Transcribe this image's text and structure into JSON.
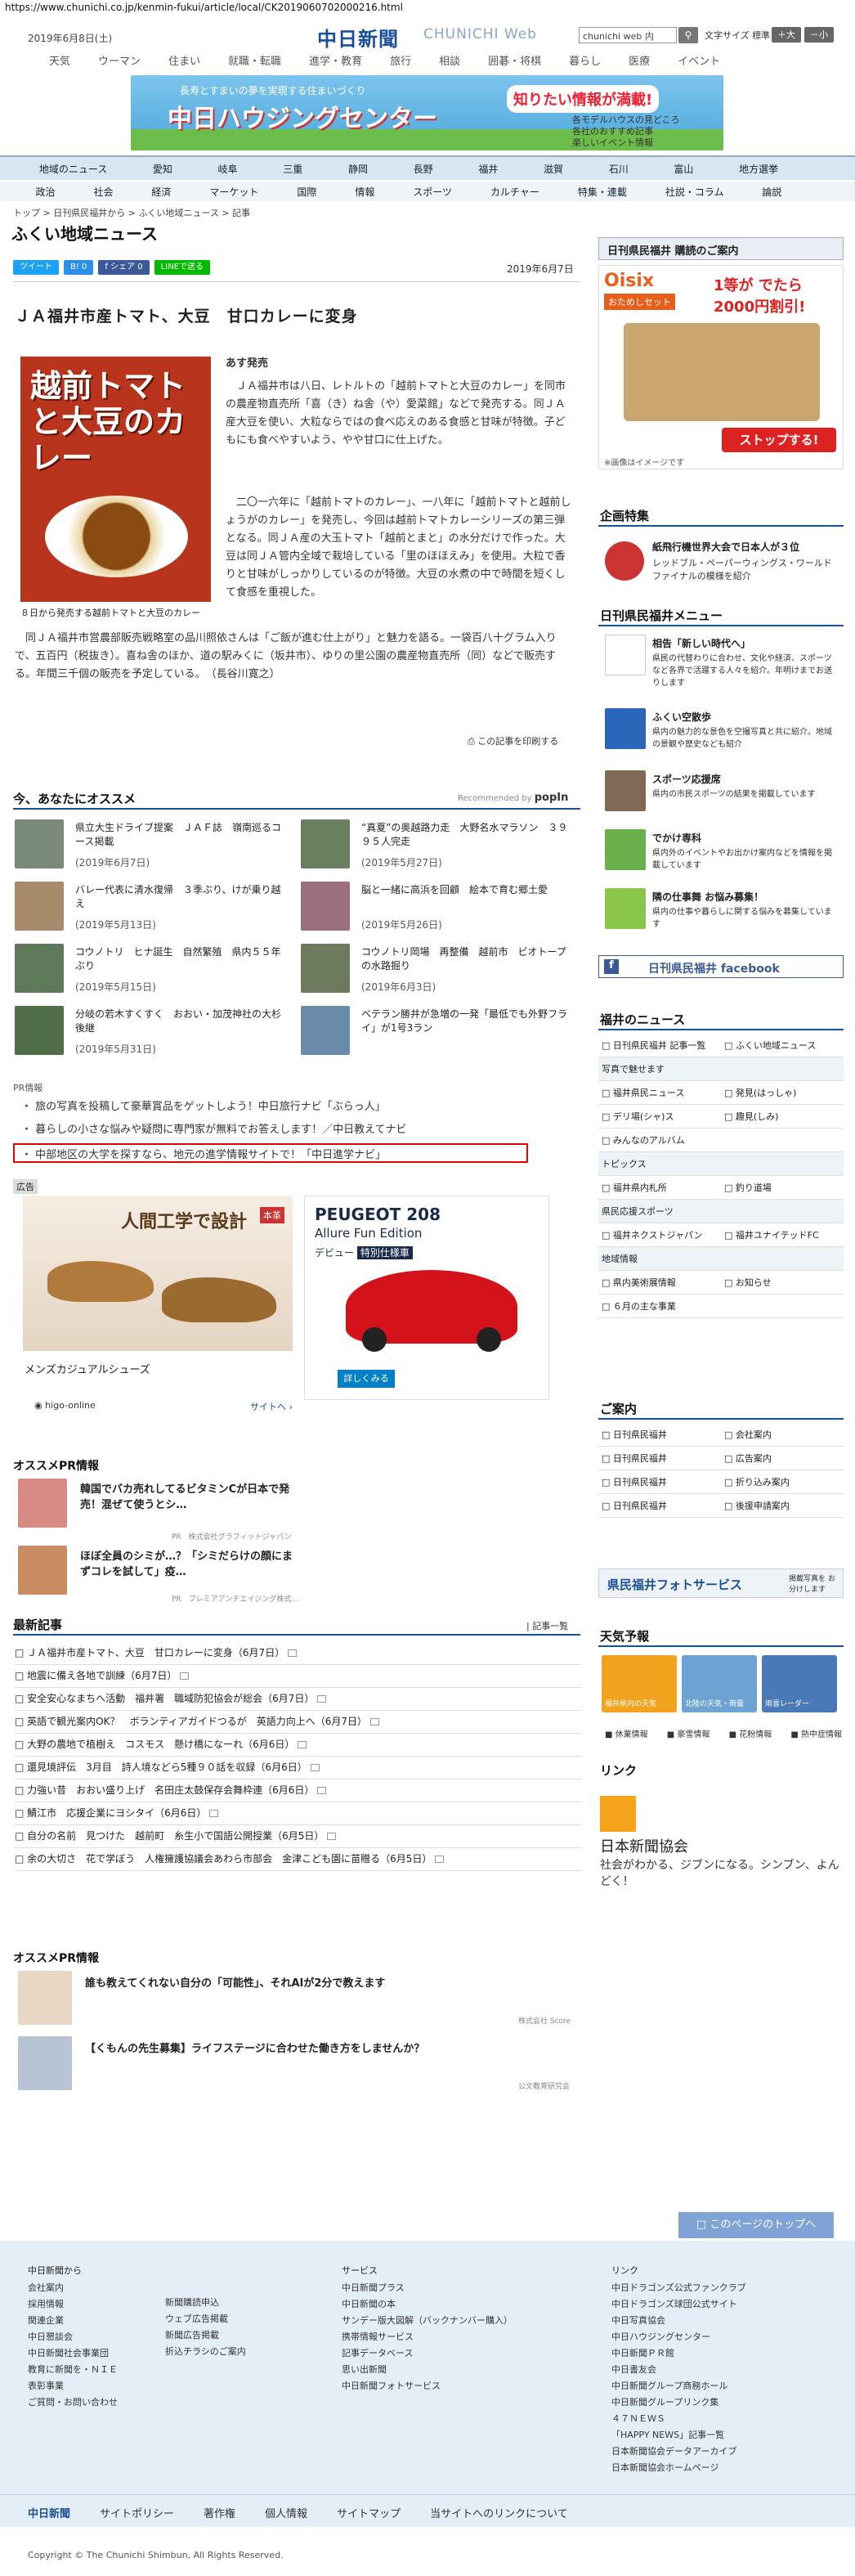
{
  "url": "https://www.chunichi.co.jp/kenmin-fukui/article/local/CK2019060702000216.html",
  "header": {
    "date": "2019年6月8日(土)",
    "logo": "中日新聞",
    "logo_sub": "CHUNICHI Web",
    "search_placeholder": "chunichi web 内",
    "search_btn": "検索",
    "font_size_label": "文字サイズ",
    "font_std": "標準",
    "font_plus": "＋大",
    "font_minus": "－小"
  },
  "top_nav": [
    "天気",
    "ウーマン",
    "住まい",
    "就職・転職",
    "進学・教育",
    "旅行",
    "相談",
    "囲碁・将棋",
    "暮らし",
    "医療",
    "イベント"
  ],
  "banner": {
    "t1": "長寿とすまいの夢を実現する住まいづくり",
    "t2": "中日ハウジングセンター",
    "t3": "知りたい情報が満載!",
    "t4": "各モデルハウスの見どころ\n各社のおすすめ記事\n楽しいイベント情報"
  },
  "cat_nav": [
    "地域のニュース",
    "愛知",
    "岐阜",
    "三重",
    "静岡",
    "長野",
    "福井",
    "滋賀",
    "石川",
    "富山",
    "地方選挙"
  ],
  "sub_nav": [
    "政治",
    "社会",
    "経済",
    "マーケット",
    "国際",
    "情報",
    "スポーツ",
    "カルチャー",
    "特集・連載",
    "社説・コラム",
    "論説"
  ],
  "breadcrumb": "トップ > 日刊県民福井から > ふくい地域ニュース > 記事",
  "section_title": "ふくい地域ニュース",
  "share": {
    "tweet": "ツイート",
    "b": "B! 0",
    "fb": "f シェア 0",
    "line": "LINEで送る"
  },
  "article": {
    "date": "2019年6月7日",
    "title": "ＪＡ福井市産トマト、大豆　甘口カレーに変身",
    "image_title": "越前トマトと大豆のカレー",
    "caption": "８日から発売する越前トマトと大豆のカレー",
    "byline": "あす発売",
    "p1": "　ＪＡ福井市は八日、レトルトの「越前トマトと大豆のカレー」を同市の農産物直売所「喜（き）ね舎（や）愛菜館」などで発売する。同ＪＡ産大豆を使い、大粒ならではの食べ応えのある食感と甘味が特徴。子どもにも食べやすいよう、やや甘口に仕上げた。",
    "p2": "　二〇一六年に「越前トマトのカレー」、一八年に「越前トマトと越前しょうがのカレー」を発売し、今回は越前トマトカレーシリーズの第三弾となる。同ＪＡ産の大玉トマト「越前とまと」の水分だけで作った。大豆は同ＪＡ管内全域で栽培している「里のほほえみ」を使用。大粒で香りと甘味がしっかりしているのが特徴。大豆の水煮の中で時間を短くして食感を重視した。",
    "p3": "　同ＪＡ福井市営農部販売戦略室の品川照依さんは「ご飯が進む仕上がり」と魅力を語る。一袋百八十グラム入りで、五百円（税抜き）。喜ね舎のほか、道の駅みくに（坂井市）、ゆりの里公園の農産物直売所（同）などで販売する。年間三千個の販売を予定している。　（長谷川寛之）",
    "print": "この記事を印刷する"
  },
  "recommend": {
    "title": "今、あなたにオススメ",
    "powered": "Recommended by",
    "powered_logo": "popIn",
    "items": [
      {
        "text": "県立大生ドライブ提案　ＪＡＦ誌　嶺南巡るコース掲載",
        "date": "(2019年6月7日)"
      },
      {
        "text": "“真夏”の奥越路力走　大野名水マラソン　３９９５人完走",
        "date": "(2019年5月27日)"
      },
      {
        "text": "バレー代表に清水復帰　３季ぶり、けが乗り越え",
        "date": "(2019年5月13日)"
      },
      {
        "text": "脳と一緒に高浜を回顧　絵本で育む郷土愛",
        "date": "(2019年5月26日)"
      },
      {
        "text": "コウノトリ　ヒナ誕生　自然繁殖　県内５５年ぶり",
        "date": "(2019年5月15日)"
      },
      {
        "text": "コウノトリ岡場　再整備　越前市　ビオトープの水路掘り",
        "date": "(2019年6月3日)"
      },
      {
        "text": "分岐の若木すくすく　おおい・加茂神社の大杉後継",
        "date": "(2019年5月31日)"
      },
      {
        "text": "ベテラン勝井が急増の一発「最低でも外野フライ」が1号3ラン",
        "date": ""
      }
    ]
  },
  "pr": {
    "label": "PR情報",
    "items": [
      "旅の写真を投稿して豪華賞品をゲットしよう！中日旅行ナビ「ぶらっ人」",
      "暮らしの小さな悩みや疑問に専門家が無料でお答えします！／中日教えてナビ",
      "中部地区の大学を探すなら、地元の進学情報サイトで！「中日進学ナビ」"
    ]
  },
  "ads": {
    "label": "広告",
    "shoe_title": "メンズカジュアルシューズ",
    "shoe_banner": "人間工学で設計",
    "shoe_badge": "本革",
    "peugeot_title": "PEUGEOT 208",
    "peugeot_sub": "Allure Fun Edition",
    "peugeot_debut": "デビュー",
    "peugeot_special": "特別仕様車",
    "peugeot_more": "詳しくみる",
    "source": "higo-online",
    "site": "サイトへ"
  },
  "osusume_pr": {
    "title": "オススメPR情報",
    "items": [
      {
        "text": "韓国でバカ売れしてるビタミンCが日本で発売！混ぜて使うとシ…",
        "src": "PR　株式会社グラフィットジャパン"
      },
      {
        "text": "ほぼ全員のシミが…？「シミだらけの顔にまずコレを試して」疫…",
        "src": "PR　プレミアアンチエイジング株式…"
      }
    ]
  },
  "latest": {
    "title": "最新記事",
    "more": "記事一覧",
    "items": [
      "ＪＡ福井市産トマト、大豆　甘口カレーに変身（6月7日）",
      "地震に備え各地で訓練（6月7日）",
      "安全安心なまちへ活動　福井署　職域防犯協会が総会（6月7日）",
      "英語で観光案内OK？　ボランティアガイドつるが　英語力向上へ（6月7日）",
      "大野の農地で植樹え　コスモス　懸け橋になーれ（6月6日）",
      "還見境評伝　3月目　詩人境などら5種９０話を収録（6月6日）",
      "力強い昔　おおい盛り上げ　名田庄太鼓保存会舞枠連（6月6日）",
      "鯖江市　応援企業にヨシタイ（6月6日）",
      "自分の名前　見つけた　越前町　糸生小で国語公開授業（6月5日）",
      "余の大切さ　花で学ぼう　人権擁護協議会あわら市部会　金津こども園に苗贈る（6月5日）"
    ]
  },
  "osusume_pr2": {
    "title": "オススメPR情報",
    "items": [
      {
        "text": "誰も教えてくれない自分の「可能性」、それAIが2分で教えます",
        "src": "株式会社 Score"
      },
      {
        "text": "【くもんの先生募集】ライフステージに合わせた働き方をしませんか？",
        "src": "公文教育研究会"
      }
    ]
  },
  "sidebar": {
    "koudoku": "日刊県民福井 購読のご案内",
    "oisix_title": "Oisix",
    "oisix_set": "おためしセット",
    "oisix_promo": "1等が でたら 2000円割引!",
    "oisix_stop": "ストップする!",
    "oisix_note": "※画像はイメージです",
    "kikaku": "企画特集",
    "kikaku_item": "紙飛行機世界大会で日本人が３位",
    "kikaku_desc": "レッドブル・ペーパーウィングス・ワールドファイナルの模様を紹介",
    "menu_title": "日刊県民福井メニュー",
    "menu": [
      {
        "h": "相告「新しい時代へ」",
        "d": "県民の代替わりに合わせ、文化や経済、スポーツなど各界で活躍する人々を紹介。年明けまでお送りします"
      },
      {
        "h": "ふくい空散歩",
        "d": "県内の魅力的な景色を空撮写真と共に紹介。地域の景観や歴史なども紹介"
      },
      {
        "h": "スポーツ応援席",
        "d": "県内の市民スポーツの結果を掲載しています"
      },
      {
        "h": "でかけ専科",
        "d": "県内外のイベントやお出かけ案内などを情報を掲載しています"
      },
      {
        "h": "隣の仕事舞 お悩み募集！",
        "d": "県内の仕事や暮らしに関する悩みを募集しています"
      }
    ],
    "facebook": "日刊県民福井 facebook",
    "news_title": "福井のニュース",
    "news": [
      [
        "日刊県民福井 記事一覧",
        "ふくい地域ニュース"
      ],
      [
        "写真で魅せます",
        ""
      ],
      [
        "福井県民ニュース",
        "発見(はっしゃ)"
      ],
      [
        "デリ場(シャ)ス",
        "趣見(しみ)"
      ],
      [
        "みんなのアルバム",
        ""
      ]
    ],
    "topics_title": "トピックス",
    "topics": [
      [
        "福井県内札所",
        "釣り道場"
      ]
    ],
    "sports_title": "県民応援スポーツ",
    "sports": [
      [
        "福井ネクストジャパン",
        "福井ユナイテッドFC"
      ]
    ],
    "region_title": "地域情報",
    "region": [
      [
        "県内美術展情報",
        "お知らせ"
      ],
      [
        "６月の主な事業",
        ""
      ]
    ],
    "guide_title": "ご案内",
    "guide": [
      [
        "日刊県民福井",
        "会社案内"
      ],
      [
        "日刊県民福井",
        "広告案内"
      ],
      [
        "日刊県民福井",
        "折り込み案内"
      ],
      [
        "日刊県民福井",
        "後援申請案内"
      ]
    ],
    "photo": "県民福井フォトサービス",
    "photo_sub": "掲載写真を お分けします",
    "weather_title": "天気予報",
    "weather": [
      "福井県内の天気",
      "北陸の天気・雨量",
      "雨雲レーダー"
    ],
    "weather_links": [
      "休業情報",
      "豪雪情報",
      "花粉情報",
      "熱中症情報"
    ],
    "link_title": "リンク",
    "link_org": "日本新聞協会",
    "link_copy": "社会がわかる、ジブンになる。シンブン、よんどく！"
  },
  "to_top": "このページのトップへ",
  "footer": {
    "col1_title": "中日新聞から",
    "col1": [
      "会社案内",
      "採用情報",
      "関連企業",
      "中日懇談会",
      "中日新聞社会事業団",
      "教育に新聞を・ＮＩＥ",
      "表彰事業",
      "ご質問・お問い合わせ"
    ],
    "col1b": [
      "新聞購読申込",
      "ウェブ広告掲載",
      "新聞広告掲載",
      "折込チラシのご案内"
    ],
    "col2_title": "サービス",
    "col2": [
      "中日新聞プラス",
      "中日新聞の本",
      "サンデー版大図解（バックナンバー購入）",
      "携帯情報サービス",
      "記事データベース",
      "思い出新聞",
      "中日新聞フォトサービス"
    ],
    "col3_title": "リンク",
    "col3": [
      "中日ドラゴンズ公式ファンクラブ",
      "中日ドラゴンズ球団公式サイト",
      "中日写真協会",
      "中日ハウジングセンター",
      "中日新聞ＰＲ館",
      "中日書友会",
      "中日新聞グループ商務ホール",
      "中日新聞グループリンク集",
      "４７ＮＥＷＳ",
      "「HAPPY NEWS」記事一覧",
      "日本新聞協会データアーカイブ",
      "日本新聞協会ホームページ"
    ],
    "bottom": [
      "中日新聞",
      "サイトポリシー",
      "著作権",
      "個人情報",
      "サイトマップ",
      "当サイトへのリンクについて"
    ],
    "copyright": "Copyright © The Chunichi Shimbun, All Rights Reserved."
  }
}
